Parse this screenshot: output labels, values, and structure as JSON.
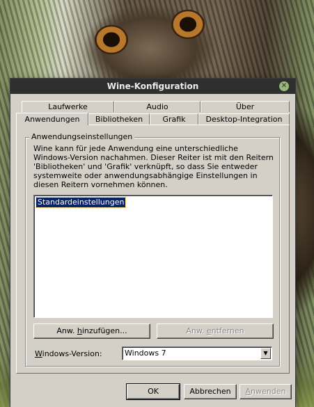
{
  "window": {
    "title": "Wine-Konfiguration",
    "close_icon": "close-icon"
  },
  "tabs_row1": [
    {
      "label": "Laufwerke"
    },
    {
      "label": "Audio"
    },
    {
      "label": "Über"
    }
  ],
  "tabs_row2": [
    {
      "label": "Anwendungen",
      "active": true
    },
    {
      "label": "Bibliotheken"
    },
    {
      "label": "Grafik"
    },
    {
      "label": "Desktop-Integration"
    }
  ],
  "group": {
    "title": "Anwendungseinstellungen",
    "description": "Wine kann für jede Anwendung eine unterschiedliche Windows-Version nachahmen. Dieser Reiter ist mit den Reitern 'Bibliotheken' und 'Grafik' verknüpft, so dass Sie entweder systemweite oder anwendungsabhängige Einstellungen in diesen Reitern vornehmen können."
  },
  "app_list": {
    "items": [
      "Standardeinstellungen"
    ],
    "selected": 0
  },
  "buttons": {
    "add_prefix": "Anw. ",
    "add_mnemonic": "h",
    "add_suffix": "inzufügen...",
    "remove_prefix": "Anw. ",
    "remove_mnemonic": "e",
    "remove_suffix": "ntfernen",
    "ok": "OK",
    "cancel": "Abbrechen",
    "apply_mnemonic": "A",
    "apply_suffix": "nwenden"
  },
  "windows_version": {
    "label_mnemonic": "W",
    "label_suffix": "indows-Version:",
    "selected": "Windows 7"
  },
  "colors": {
    "titlebar": "#2f2f2f",
    "dialog": "#d4d0c8",
    "selection": "#0a246a",
    "close": "#9ab87a"
  }
}
